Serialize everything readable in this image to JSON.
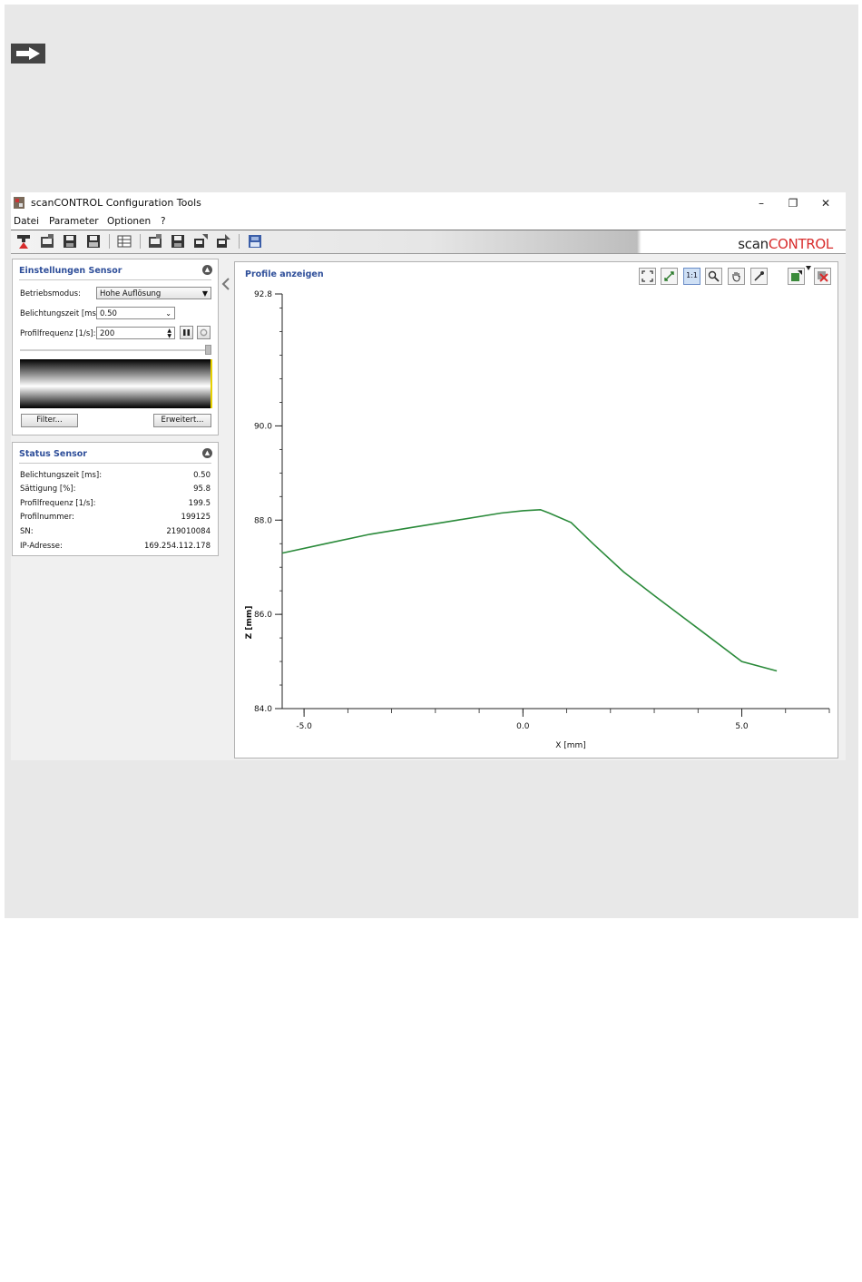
{
  "window": {
    "title": "scanCONTROL Configuration Tools",
    "controls": {
      "minimize": "–",
      "restore": "❐",
      "close": "✕"
    }
  },
  "menu": [
    "Datei",
    "Parameter",
    "Optionen",
    "?"
  ],
  "brand": {
    "part1": "scan",
    "part2": "CONTROL",
    "color_part1": "#222222",
    "color_part2": "#d82c2c"
  },
  "settings": {
    "header": "Einstellungen Sensor",
    "betriebsmodus_label": "Betriebsmodus:",
    "betriebsmodus_value": "Hohe Auflösung",
    "belichtungszeit_label": "Belichtungszeit [ms]:",
    "belichtungszeit_value": "0.50",
    "profilfrequenz_label": "Profilfrequenz [1/s]:",
    "profilfrequenz_value": "200",
    "filter_button": "Filter...",
    "erweitert_button": "Erweitert..."
  },
  "status": {
    "header": "Status Sensor",
    "rows": [
      {
        "label": "Belichtungszeit [ms]:",
        "value": "0.50"
      },
      {
        "label": "Sättigung [%]:",
        "value": "95.8"
      },
      {
        "label": "Profilfrequenz [1/s]:",
        "value": "199.5"
      },
      {
        "label": "Profilnummer:",
        "value": "199125"
      },
      {
        "label": "SN:",
        "value": "219010084"
      },
      {
        "label": "IP-Adresse:",
        "value": "169.254.112.178"
      }
    ]
  },
  "profile_view": {
    "title": "Profile anzeigen",
    "toolbar_icons": [
      "fit-view-icon",
      "auto-scale-icon",
      "one-to-one-icon",
      "zoom-icon",
      "pan-hand-icon",
      "picker-icon",
      "export-icon",
      "clear-icon"
    ],
    "one_to_one_label": "1:1"
  },
  "colors": {
    "accent": "#2f4f9a",
    "profile_line": "#2a8a3a",
    "panel_background": "#e8e8e8"
  },
  "chart_data": {
    "type": "line",
    "xlabel": "X [mm]",
    "ylabel": "Z [mm]",
    "xlim": [
      -5.5,
      7.0
    ],
    "ylim": [
      84.0,
      92.8
    ],
    "x_ticks": [
      -5.0,
      0.0,
      5.0
    ],
    "x_tick_labels": [
      "-5.0",
      "0.0",
      "5.0"
    ],
    "y_ticks": [
      84.0,
      86.0,
      88.0,
      90.0,
      92.8
    ],
    "y_tick_labels": [
      "84.0",
      "86.0",
      "88.0",
      "90.0",
      "92.8"
    ],
    "series": [
      {
        "x": [
          -5.5,
          -4.5,
          -3.5,
          -2.5,
          -1.5,
          -0.5,
          0.0,
          0.4,
          0.6,
          1.1,
          1.6,
          2.3,
          3.0,
          4.0,
          5.0,
          5.8
        ],
        "y": [
          87.3,
          87.5,
          87.7,
          87.85,
          88.0,
          88.15,
          88.2,
          88.22,
          88.15,
          87.95,
          87.5,
          86.9,
          86.4,
          85.7,
          85.0,
          84.8
        ]
      }
    ]
  }
}
